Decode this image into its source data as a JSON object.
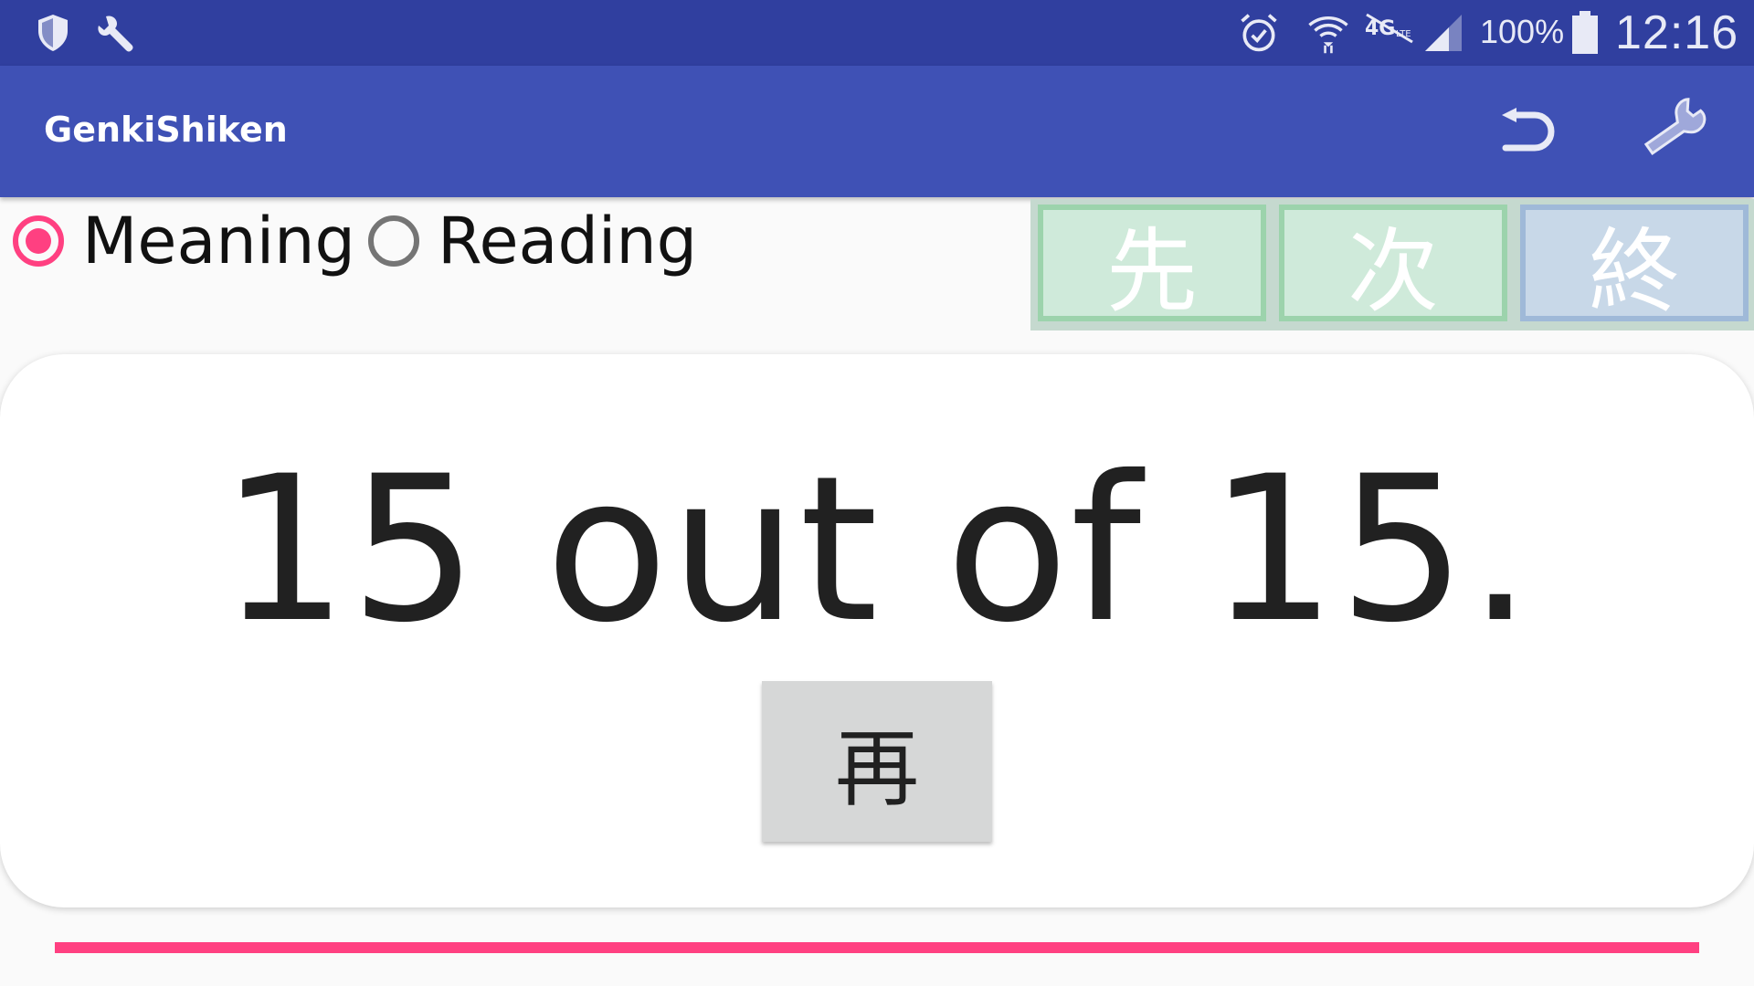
{
  "status_bar": {
    "left_icons": [
      "shield-icon",
      "wrench-icon"
    ],
    "right_icons": [
      "alarm-icon",
      "wifi-icon",
      "lte-icon",
      "signal-icon",
      "battery-icon"
    ],
    "battery_percent": "100%",
    "time": "12:16",
    "colors": {
      "background": "#303f9f",
      "foreground": "#e8eaf6"
    }
  },
  "app_bar": {
    "title": "GenkiShiken",
    "actions": [
      "undo-icon",
      "wrench-icon"
    ],
    "colors": {
      "background": "#3f51b5",
      "foreground": "#ffffff"
    }
  },
  "mode": {
    "options": [
      {
        "label": "Meaning",
        "checked": true
      },
      {
        "label": "Reading",
        "checked": false
      }
    ],
    "accent": "#ff4081"
  },
  "kanji_buttons": [
    {
      "label": "先",
      "color": "#cfeada"
    },
    {
      "label": "次",
      "color": "#cfeada"
    },
    {
      "label": "終",
      "color": "#c8d8e8"
    }
  ],
  "result": {
    "text": "15 out of 15.",
    "retry_label": "再"
  },
  "progress": {
    "value": 1.0,
    "color": "#ff4081"
  }
}
